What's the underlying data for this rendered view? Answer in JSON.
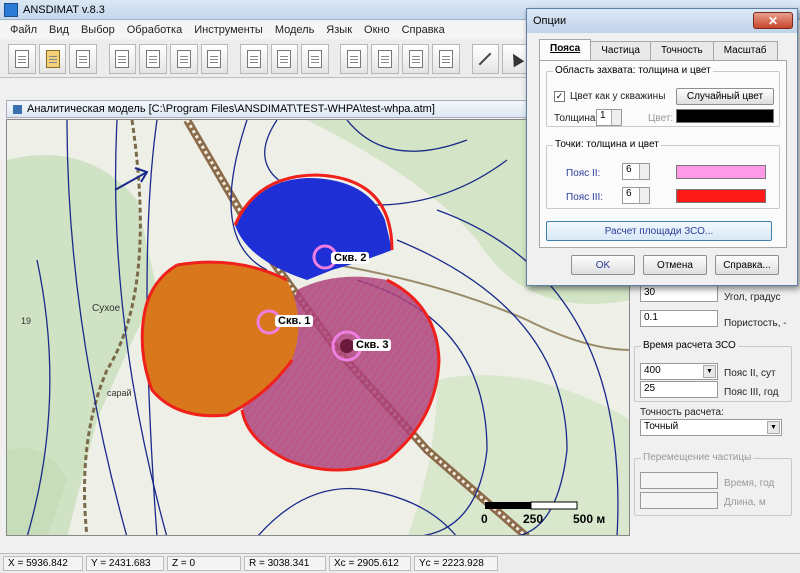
{
  "app": {
    "title": "ANSDIMAT v.8.3"
  },
  "menu": [
    "Файл",
    "Вид",
    "Выбор",
    "Обработка",
    "Инструменты",
    "Модель",
    "Язык",
    "Окно",
    "Справка"
  ],
  "document": {
    "title": "Аналитическая модель  [C:\\Program Files\\ANSDIMAT\\TEST-WHPA\\test-whpa.atm]"
  },
  "map": {
    "wells": [
      {
        "label": "Скв. 1"
      },
      {
        "label": "Скв. 2"
      },
      {
        "label": "Скв. 3"
      }
    ],
    "scale": {
      "tick0": "0",
      "tick1": "250",
      "tick2": "500 м"
    },
    "place_labels": [
      "Сухое",
      "сарай",
      "19"
    ],
    "colors": {
      "zone_blue": "#1f2fd6",
      "zone_orange": "#d9771c",
      "zone_pink": "#b0407a",
      "boundary_red": "#f0201a",
      "isolines": "#1a2a8a"
    }
  },
  "options_dialog": {
    "title": "Опции",
    "close": "✕",
    "tabs": [
      "Пояса",
      "Частица",
      "Точность",
      "Масштаб"
    ],
    "active_tab": "Пояса",
    "capture_group": {
      "title": "Область захвата: толщина и цвет",
      "checkbox_label": "Цвет как у скважины",
      "checkbox_checked": "✓",
      "random_color_button": "Случайный цвет",
      "thickness_label": "Толщина:",
      "thickness_value": "1",
      "color_label": "Цвет:",
      "color_value": "#000000"
    },
    "points_group": {
      "title": "Точки: толщина и цвет",
      "belt2_label": "Пояс II:",
      "belt2_value": "6",
      "belt2_color": "#ff99e8",
      "belt3_label": "Пояс III:",
      "belt3_value": "6",
      "belt3_color": "#ff1a1a"
    },
    "calc_area_button": "Расчет площади ЗСО...",
    "ok": "OK",
    "cancel": "Отмена",
    "help": "Справка..."
  },
  "right_panel": {
    "angle_value": "30",
    "angle_label": "Угол, градус",
    "porosity_value": "0.1",
    "porosity_label": "Пористость, -",
    "time_group_title": "Время расчета ЗСО",
    "belt2_time_value": "400",
    "belt2_time_label": "Пояс II, сут",
    "belt3_time_value": "25",
    "belt3_time_label": "Пояс III, год",
    "precision_label": "Точность расчета:",
    "precision_value": "Точный",
    "particle_group_title": "Перемещение частицы",
    "time_label": "Время, год",
    "length_label": "Длина, м"
  },
  "status": {
    "x": "X = 5936.842",
    "y": "Y = 2431.683",
    "z": "Z = 0",
    "r": "R = 3038.341",
    "xc": "Xc = 2905.612",
    "yc": "Yc = 2223.928"
  }
}
